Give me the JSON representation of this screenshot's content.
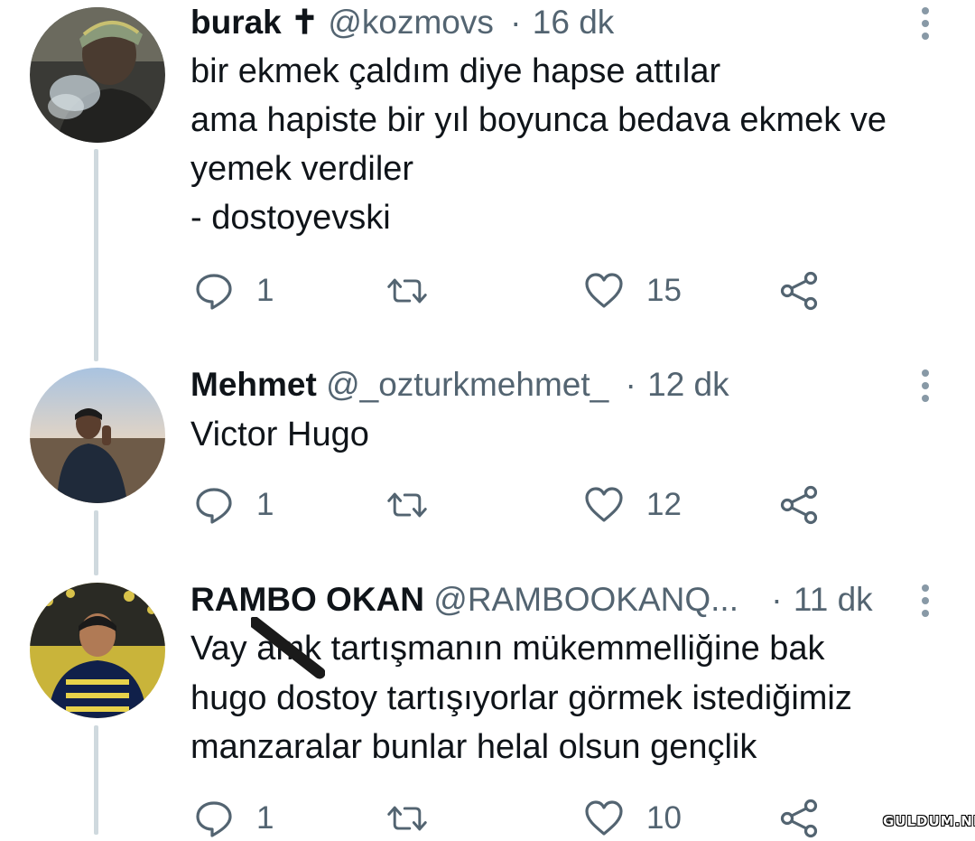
{
  "tweets": [
    {
      "name": "burak ✝",
      "handle": "@kozmovs",
      "time": "16 dk",
      "lines": [
        "bir ekmek çaldım diye hapse attılar",
        "ama hapiste bir yıl boyunca bedava ekmek ve",
        "yemek verdiler",
        "- dostoyevski"
      ],
      "reply_count": "1",
      "retweet_count": "",
      "like_count": "15"
    },
    {
      "name": "Mehmet",
      "handle": "@_ozturkmehmet_",
      "time": "12 dk",
      "lines": [
        "Victor Hugo"
      ],
      "reply_count": "1",
      "retweet_count": "",
      "like_count": "12"
    },
    {
      "name": "RAMBO OKAN",
      "handle": "@RAMBOOKANQ...",
      "time": "11 dk",
      "lines": [
        "Vay amk tartışmanın mükemmelliğine bak",
        "hugo dostoy tartışıyorlar görmek istediğimiz",
        "manzaralar bunlar helal olsun gençlik"
      ],
      "reply_count": "1",
      "retweet_count": "",
      "like_count": "10"
    }
  ],
  "separator": "·",
  "watermark": "GULDUM.NET",
  "colors": {
    "text": "#0f1419",
    "secondary": "#536471",
    "thread_line": "#cfd9de",
    "icon": "#536471"
  }
}
